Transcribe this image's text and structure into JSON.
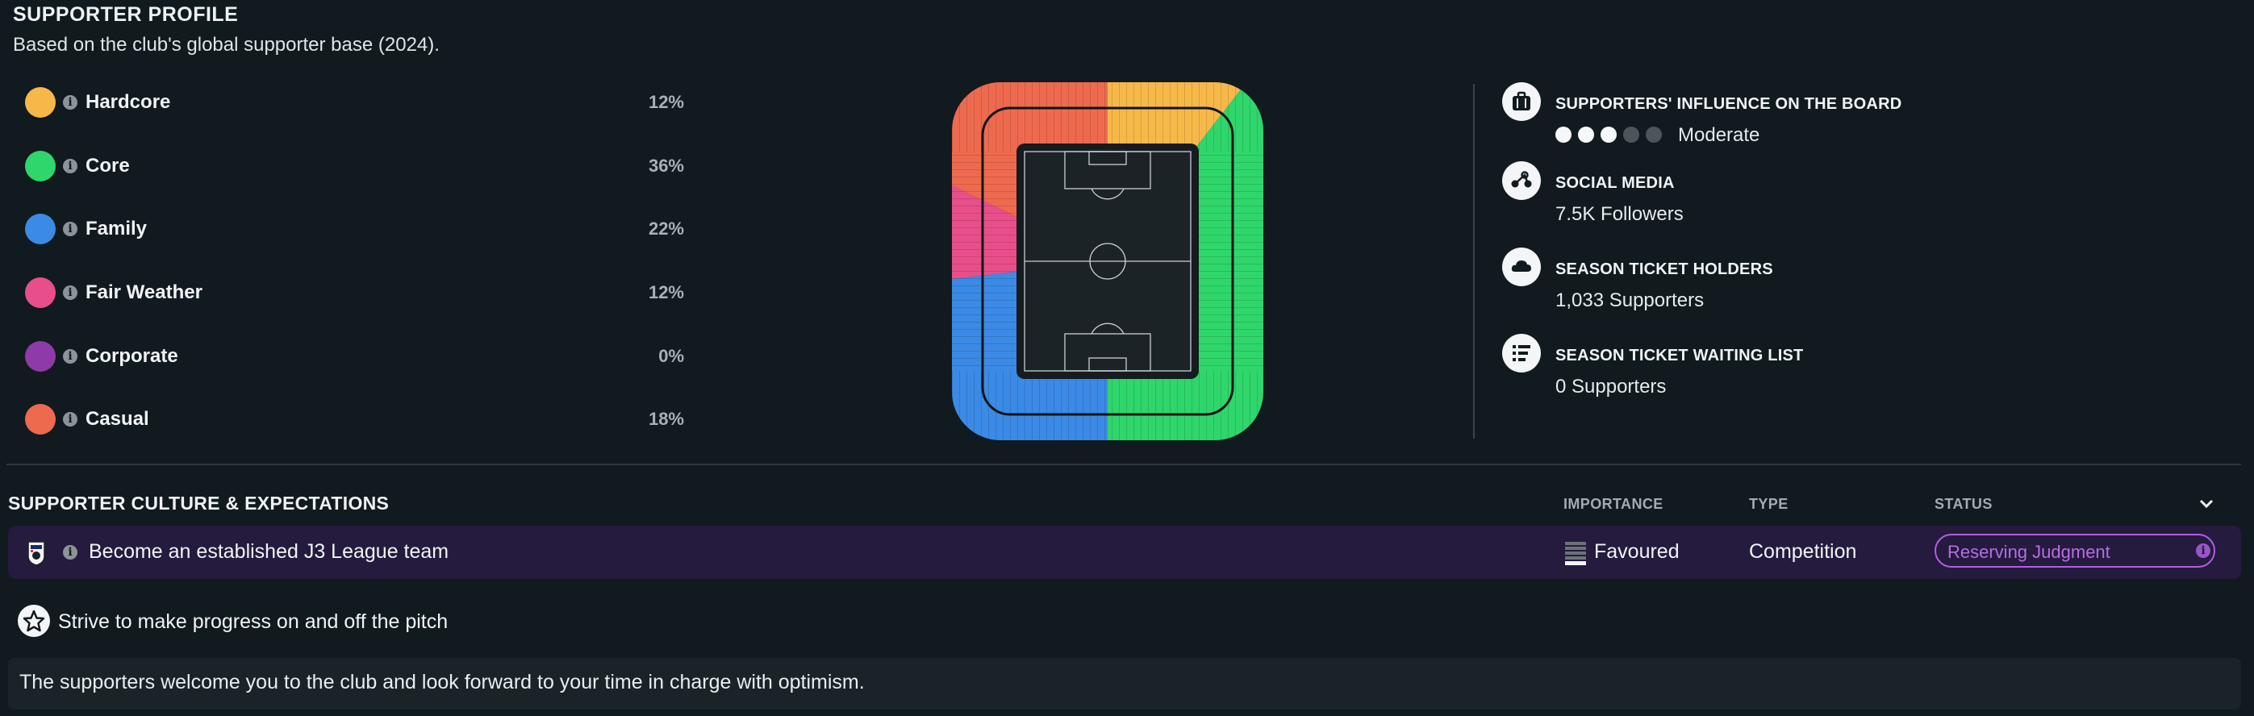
{
  "header": {
    "title": "SUPPORTER PROFILE",
    "subtitle": "Based on the club's global supporter base (2024)."
  },
  "segments": [
    {
      "name": "Hardcore",
      "percent": "12%",
      "color": "#f7b84a"
    },
    {
      "name": "Core",
      "percent": "36%",
      "color": "#2fd66b"
    },
    {
      "name": "Family",
      "percent": "22%",
      "color": "#3b8ae6"
    },
    {
      "name": "Fair Weather",
      "percent": "12%",
      "color": "#e84f8a"
    },
    {
      "name": "Corporate",
      "percent": "0%",
      "color": "#8e3aa8"
    },
    {
      "name": "Casual",
      "percent": "18%",
      "color": "#ee6a4f"
    }
  ],
  "influence": {
    "board": {
      "label": "SUPPORTERS' INFLUENCE ON THE BOARD",
      "value": "Moderate",
      "level": 3,
      "max": 5,
      "icon": "briefcase-icon"
    },
    "social": {
      "label": "SOCIAL MEDIA",
      "value": "7.5K Followers",
      "icon": "share-icon"
    },
    "season_ticket": {
      "label": "SEASON TICKET HOLDERS",
      "value": "1,033 Supporters",
      "icon": "cloud-icon"
    },
    "waiting_list": {
      "label": "SEASON TICKET WAITING LIST",
      "value": "0 Supporters",
      "icon": "list-icon"
    }
  },
  "culture": {
    "title": "SUPPORTER CULTURE & EXPECTATIONS",
    "columns": {
      "importance": "IMPORTANCE",
      "type": "TYPE",
      "status": "STATUS"
    },
    "expectation": {
      "text": "Become an established J3 League team",
      "importance": "Favoured",
      "type": "Competition",
      "status": "Reserving Judgment"
    },
    "strive": "Strive to make progress on and off the pitch",
    "message": "The supporters welcome you to the club and look forward to your time in charge with optimism."
  }
}
